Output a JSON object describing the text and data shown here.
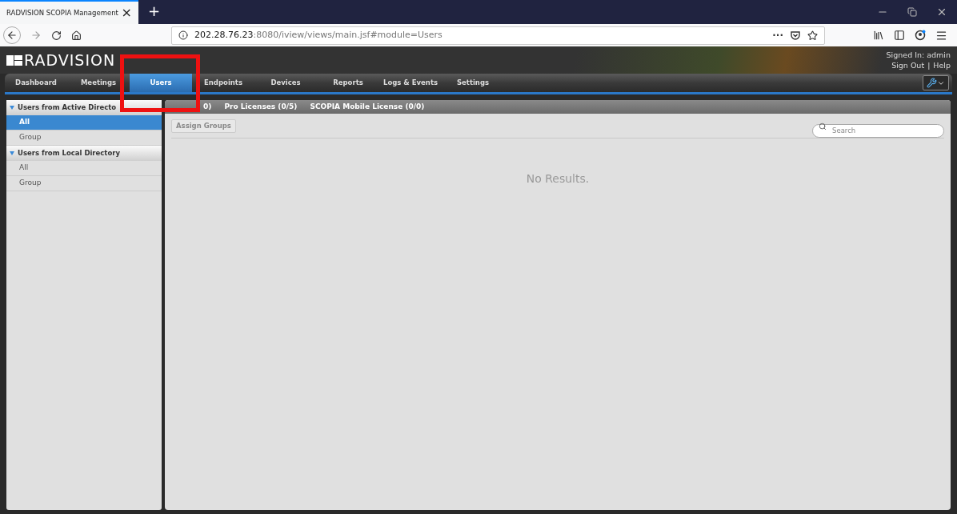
{
  "browser": {
    "tab_title": "RADVISION SCOPIA Management",
    "tab_close": "×",
    "new_tab": "+",
    "url_host": "202.28.76.23",
    "url_rest": ":8080/iview/views/main.jsf#module=Users",
    "page_actions": "···"
  },
  "header": {
    "logo": "RADVISION",
    "signed_in": "Signed In: admin",
    "sign_out": "Sign Out",
    "separator": "|",
    "help": "Help"
  },
  "nav": [
    {
      "label": "Dashboard",
      "selected": false
    },
    {
      "label": "Meetings",
      "selected": false
    },
    {
      "label": "Users",
      "selected": true
    },
    {
      "label": "Endpoints",
      "selected": false
    },
    {
      "label": "Devices",
      "selected": false
    },
    {
      "label": "Reports",
      "selected": false
    },
    {
      "label": "Logs & Events",
      "selected": false
    },
    {
      "label": "Settings",
      "selected": false
    }
  ],
  "sidebar": [
    {
      "title": "Users from Active Directo",
      "expanded": true,
      "items": [
        {
          "label": "All",
          "selected": true
        },
        {
          "label": "Group",
          "selected": false
        }
      ]
    },
    {
      "title": "Users from Local Directory",
      "expanded": true,
      "items": [
        {
          "label": "All",
          "selected": false
        },
        {
          "label": "Group",
          "selected": false
        }
      ]
    }
  ],
  "main": {
    "tabs": [
      "0)",
      "Pro Licenses (0/5)",
      "SCOPIA Mobile License (0/0)"
    ],
    "assign_button": {
      "label": "Assign Groups",
      "disabled": true
    },
    "search": {
      "placeholder": "Search"
    },
    "empty": "No Results."
  },
  "annotation": {
    "kind": "highlight",
    "color": "#ee1111"
  }
}
